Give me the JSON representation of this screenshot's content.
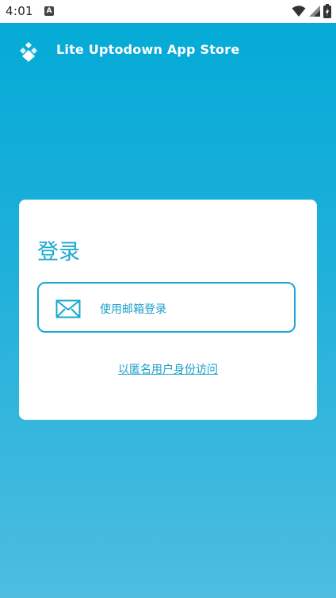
{
  "status_bar": {
    "time": "4:01",
    "notification_icon": "A",
    "icons": [
      "wifi-icon",
      "signal-icon",
      "battery-icon"
    ]
  },
  "header": {
    "title": "Lite Uptodown App Store",
    "logo_icon": "uptodown-logo"
  },
  "login": {
    "title": "登录",
    "email_button_label": "使用邮箱登录",
    "email_icon": "envelope-icon",
    "anonymous_link": "以匿名用户身份访问"
  },
  "colors": {
    "accent": "#19a8d0",
    "background_top": "#02aad6",
    "background_bottom": "#4dbde0",
    "card": "#ffffff"
  }
}
